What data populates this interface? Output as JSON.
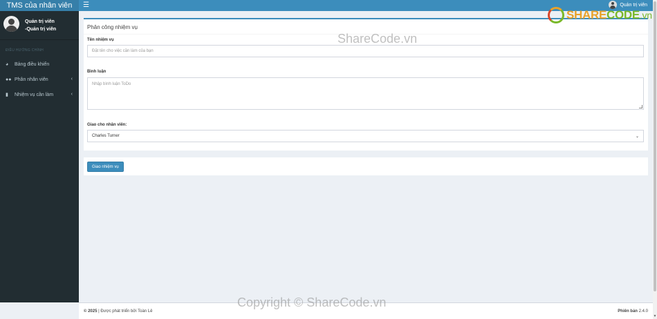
{
  "header": {
    "app_title": "TMS của nhân viên",
    "user_name": "Quản trị viên"
  },
  "sidebar": {
    "user_name": "Quản trị viên",
    "user_role": "-Quản trị viên",
    "section_label": "ĐIỀU HƯỚNG CHÍNH",
    "items": [
      {
        "label": "Bảng điều khiển",
        "icon": "dashboard-icon"
      },
      {
        "label": "Phân nhân viên",
        "icon": "users-icon"
      },
      {
        "label": "Nhiệm vụ cần làm",
        "icon": "file-icon"
      }
    ]
  },
  "form": {
    "title": "Phân công nhiệm vụ",
    "task_label": "Tên nhiệm vụ",
    "task_placeholder": "Đặt tên cho việc cần làm của bạn",
    "comment_label": "Bình luận",
    "comment_placeholder": "Nhập bình luận ToDo",
    "assign_label": "Giao cho nhân viên:",
    "assign_selected": "Charles Turner",
    "submit_label": "Giao nhiệm vụ"
  },
  "footer": {
    "year": "© 2025",
    "credit": "| Được phát triển bởi Toàn Lê",
    "version_label": "Phiên bản",
    "version": "2.4.0"
  },
  "watermark": {
    "center": "ShareCode.vn",
    "bottom": "Copyright © ShareCode.vn",
    "logo_main": "SHARE",
    "logo_code": "CODE",
    "logo_suffix": ".vn"
  },
  "colors": {
    "accent": "#3c8dbc",
    "sidebar": "#222d32",
    "background": "#ecf0f5"
  }
}
